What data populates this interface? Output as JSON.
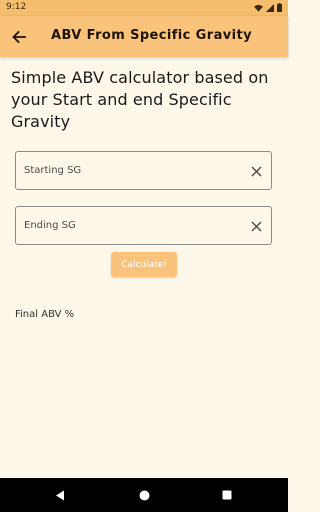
{
  "status_bar": {
    "time": "9:12"
  },
  "app_bar": {
    "title": "ABV From Specific Gravity",
    "back_icon": "arrow-back-icon"
  },
  "main": {
    "headline": "Simple ABV calculator based on your Start and end Specific Gravity",
    "starting_sg": {
      "placeholder": "Starting SG",
      "value": ""
    },
    "ending_sg": {
      "placeholder": "Ending SG",
      "value": ""
    },
    "calculate_label": "Calculate!",
    "result_label": "Final ABV %"
  },
  "colors": {
    "accent": "#f9c37c",
    "background": "#fdf7ea"
  }
}
